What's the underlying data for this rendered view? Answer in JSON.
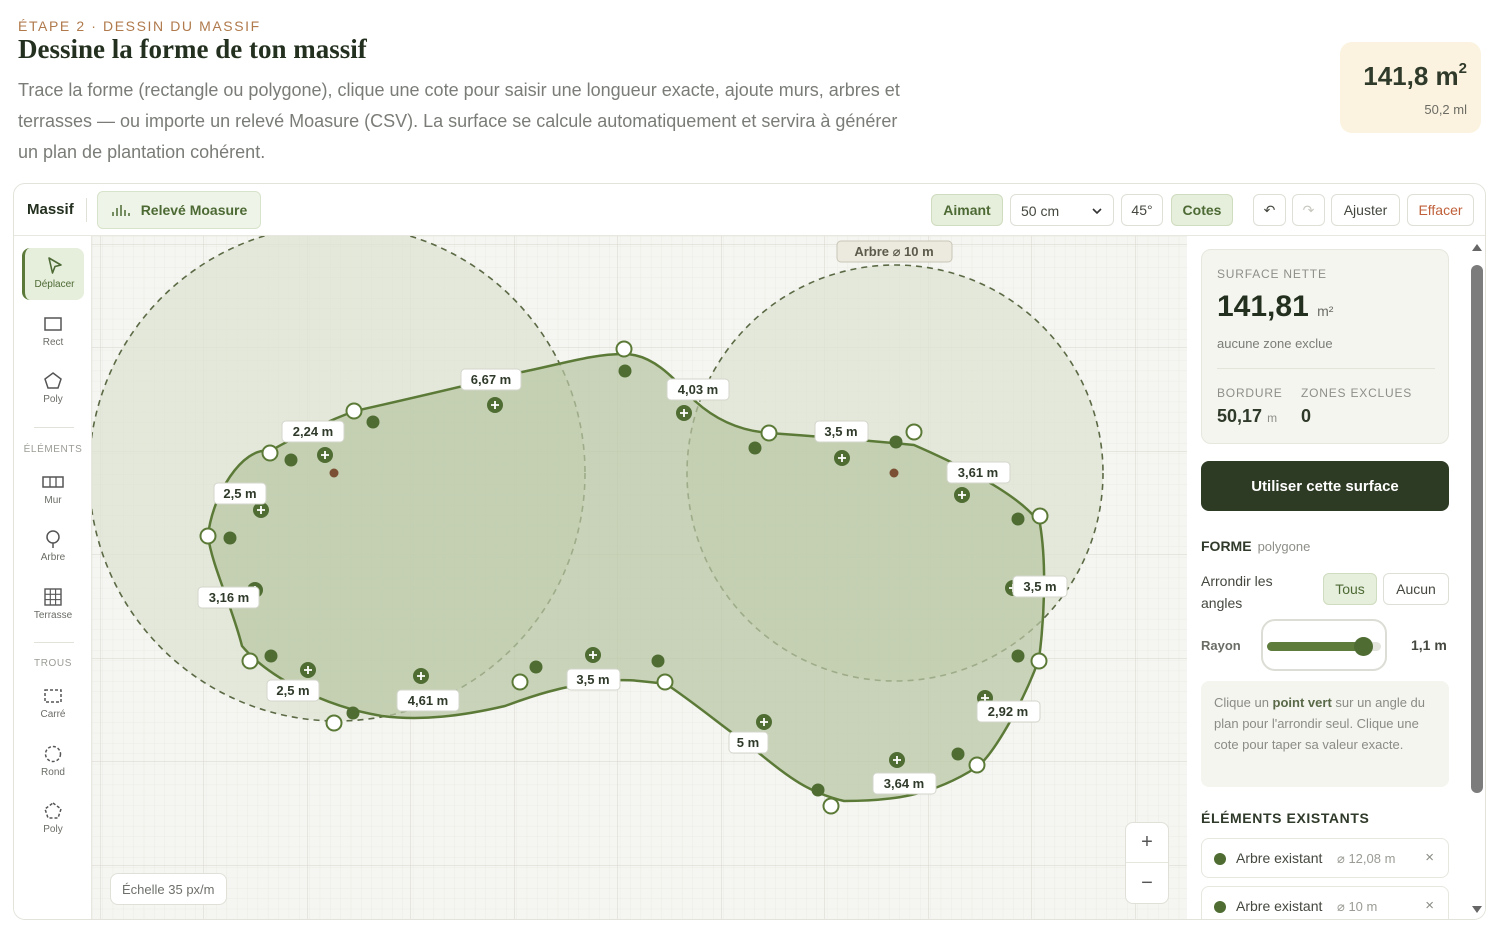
{
  "header": {
    "step": "ÉTAPE 2 · DESSIN DU MASSIF",
    "title": "Dessine la forme de ton massif",
    "description": "Trace la forme (rectangle ou polygone), clique une cote pour saisir une longueur exacte, ajoute murs, arbres et terrasses — ou importe un relevé Moasure (CSV). La surface se calcule automatiquement et servira à générer un plan de plantation cohérent.",
    "area_value": "141,8 m",
    "area_sup": "2",
    "area_sub": "50,2 ml"
  },
  "toolbar": {
    "title": "Massif",
    "moasure_label": "Relevé Moasure",
    "aimant_label": "Aimant",
    "grid_select_value": "50 cm",
    "angle_label": "45°",
    "cotes_label": "Cotes",
    "undo_icon": "↶",
    "redo_icon": "↷",
    "ajuster_label": "Ajuster",
    "effacer_label": "Effacer"
  },
  "tools": {
    "deplacer": "Déplacer",
    "rect": "Rect",
    "poly": "Poly",
    "elements_section": "ÉLÉMENTS",
    "mur": "Mur",
    "arbre": "Arbre",
    "terrasse": "Terrasse",
    "trous_section": "TROUS",
    "carre": "Carré",
    "rond": "Rond",
    "poly_trou": "Poly"
  },
  "canvas": {
    "tree_label": "Arbre ⌀ 10 m",
    "scale_label": "Échelle 35 px/m",
    "zoom_in": "+",
    "zoom_out": "−",
    "dimensions": [
      "6,67 m",
      "4,03 m",
      "2,24 m",
      "3,5 m",
      "3,61 m",
      "2,5 m",
      "3,16 m",
      "3,5 m",
      "2,5 m",
      "4,61 m",
      "3,5 m",
      "5 m",
      "2,92 m",
      "3,64 m"
    ]
  },
  "panel": {
    "surface_label": "SURFACE NETTE",
    "surface_value": "141,81",
    "surface_unit": "m²",
    "surface_sub": "aucune zone exclue",
    "bordure_label": "BORDURE",
    "bordure_value": "50,17",
    "bordure_unit": "m",
    "zones_label": "ZONES EXCLUES",
    "zones_value": "0",
    "use_button": "Utiliser cette surface",
    "forme_label": "FORME",
    "forme_value": "polygone",
    "arrondir_label": "Arrondir les angles",
    "tous_label": "Tous",
    "aucun_label": "Aucun",
    "rayon_label": "Rayon",
    "rayon_value": "1,1 m",
    "rayon_fraction": 0.84,
    "hint_pre": "Clique un ",
    "hint_bold": "point vert",
    "hint_post": " sur un angle du plan pour l'arrondir seul. Clique une cote pour taper sa valeur exacte.",
    "elements_title": "ÉLÉMENTS EXISTANTS",
    "elements": [
      {
        "name": "Arbre existant",
        "diameter": "⌀ 12,08 m",
        "remove": "×"
      },
      {
        "name": "Arbre existant",
        "diameter": "⌀ 10 m",
        "remove": "×"
      }
    ]
  },
  "colors": {
    "accent": "#4f6d33",
    "dark_button": "#2e3b24",
    "shape_fill": "#c6d1b4",
    "tree_fill": "#d8dfcd",
    "step_color": "#b07a4c"
  }
}
